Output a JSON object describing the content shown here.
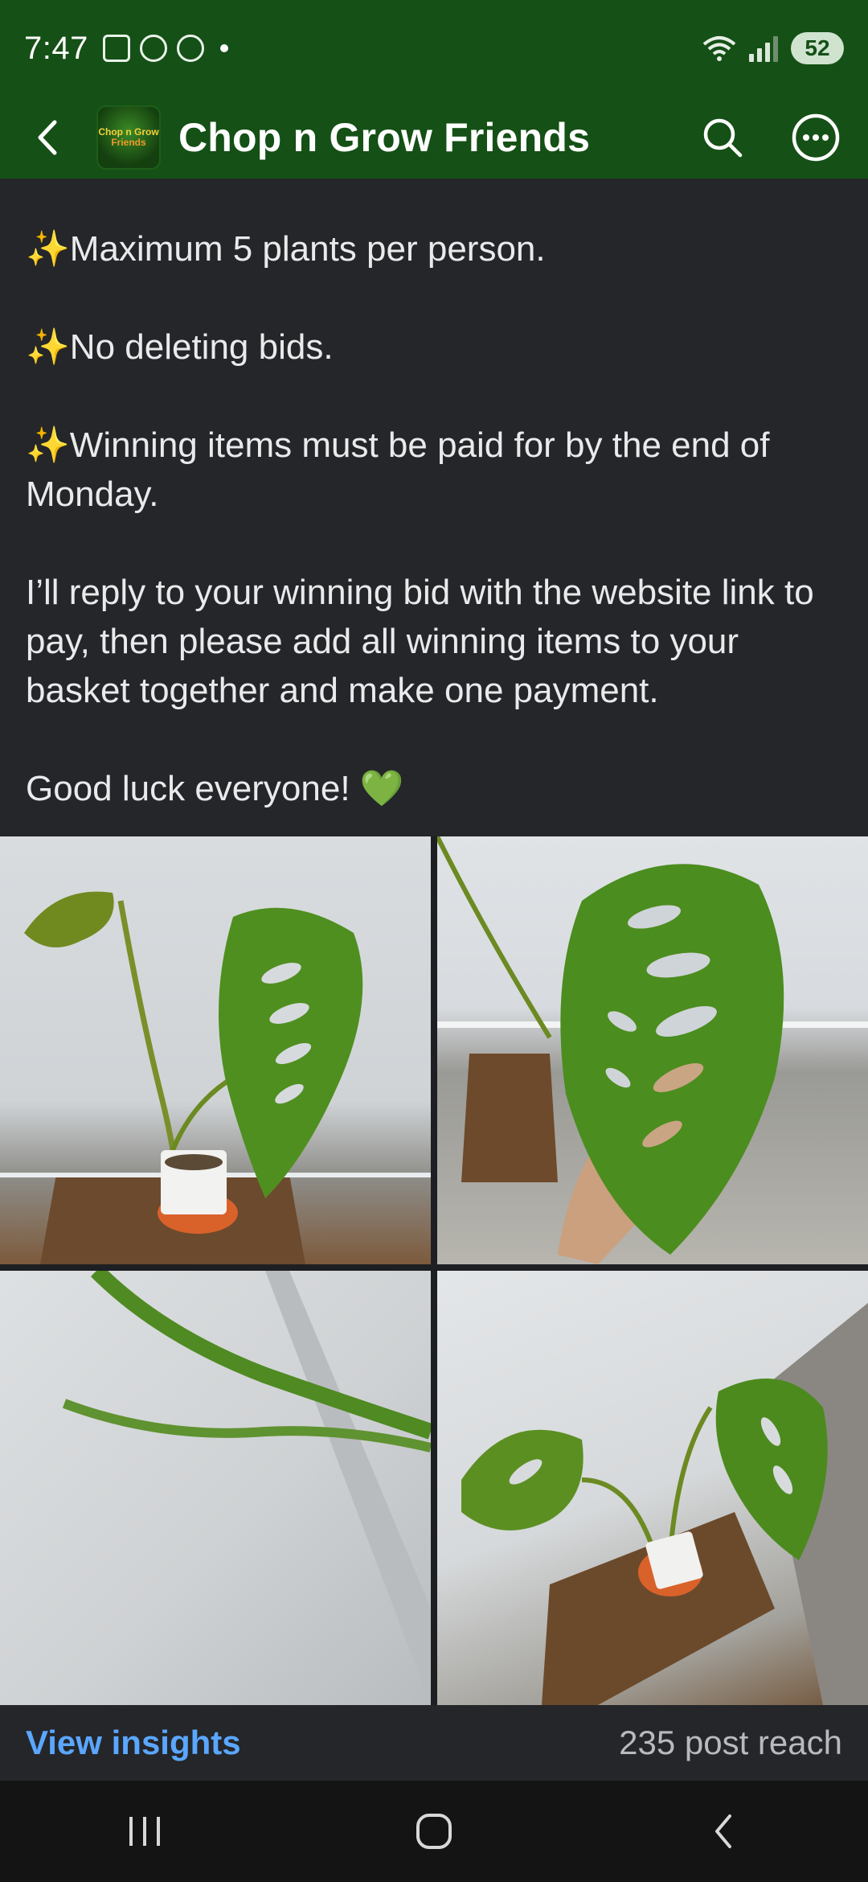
{
  "status_bar": {
    "time": "7:47",
    "battery": "52",
    "icons": [
      "screenshot-icon",
      "threads-icon",
      "chatgpt-icon",
      "notification-dot",
      "wifi-icon",
      "signal-icon",
      "battery-icon"
    ]
  },
  "header": {
    "group_name": "Chop n Grow Friends",
    "avatar_text_1": "Chop n Grow",
    "avatar_text_2": "Friends",
    "colors": {
      "background": "#155016",
      "text": "#ffffff"
    }
  },
  "post": {
    "lines": {
      "rule1": "Maximum 5 plants per person.",
      "rule2": "No deleting bids.",
      "rule3": "Winning items must be paid for by the end of Monday.",
      "paragraph": "I’ll reply to your winning bid with the website link to pay, then please add all winning items to your basket together and make one payment.",
      "closing": "Good luck everyone!"
    },
    "sparkle_emoji": "✨",
    "heart_emoji": "💚"
  },
  "photos": [
    "monstera-plant-photo-1",
    "monstera-leaf-in-hand-photo",
    "monstera-stem-closeup-photo",
    "monstera-plant-photo-2"
  ],
  "footer": {
    "view_insights": "View insights",
    "post_reach": "235 post reach",
    "colors": {
      "link": "#5aa7ff"
    }
  }
}
